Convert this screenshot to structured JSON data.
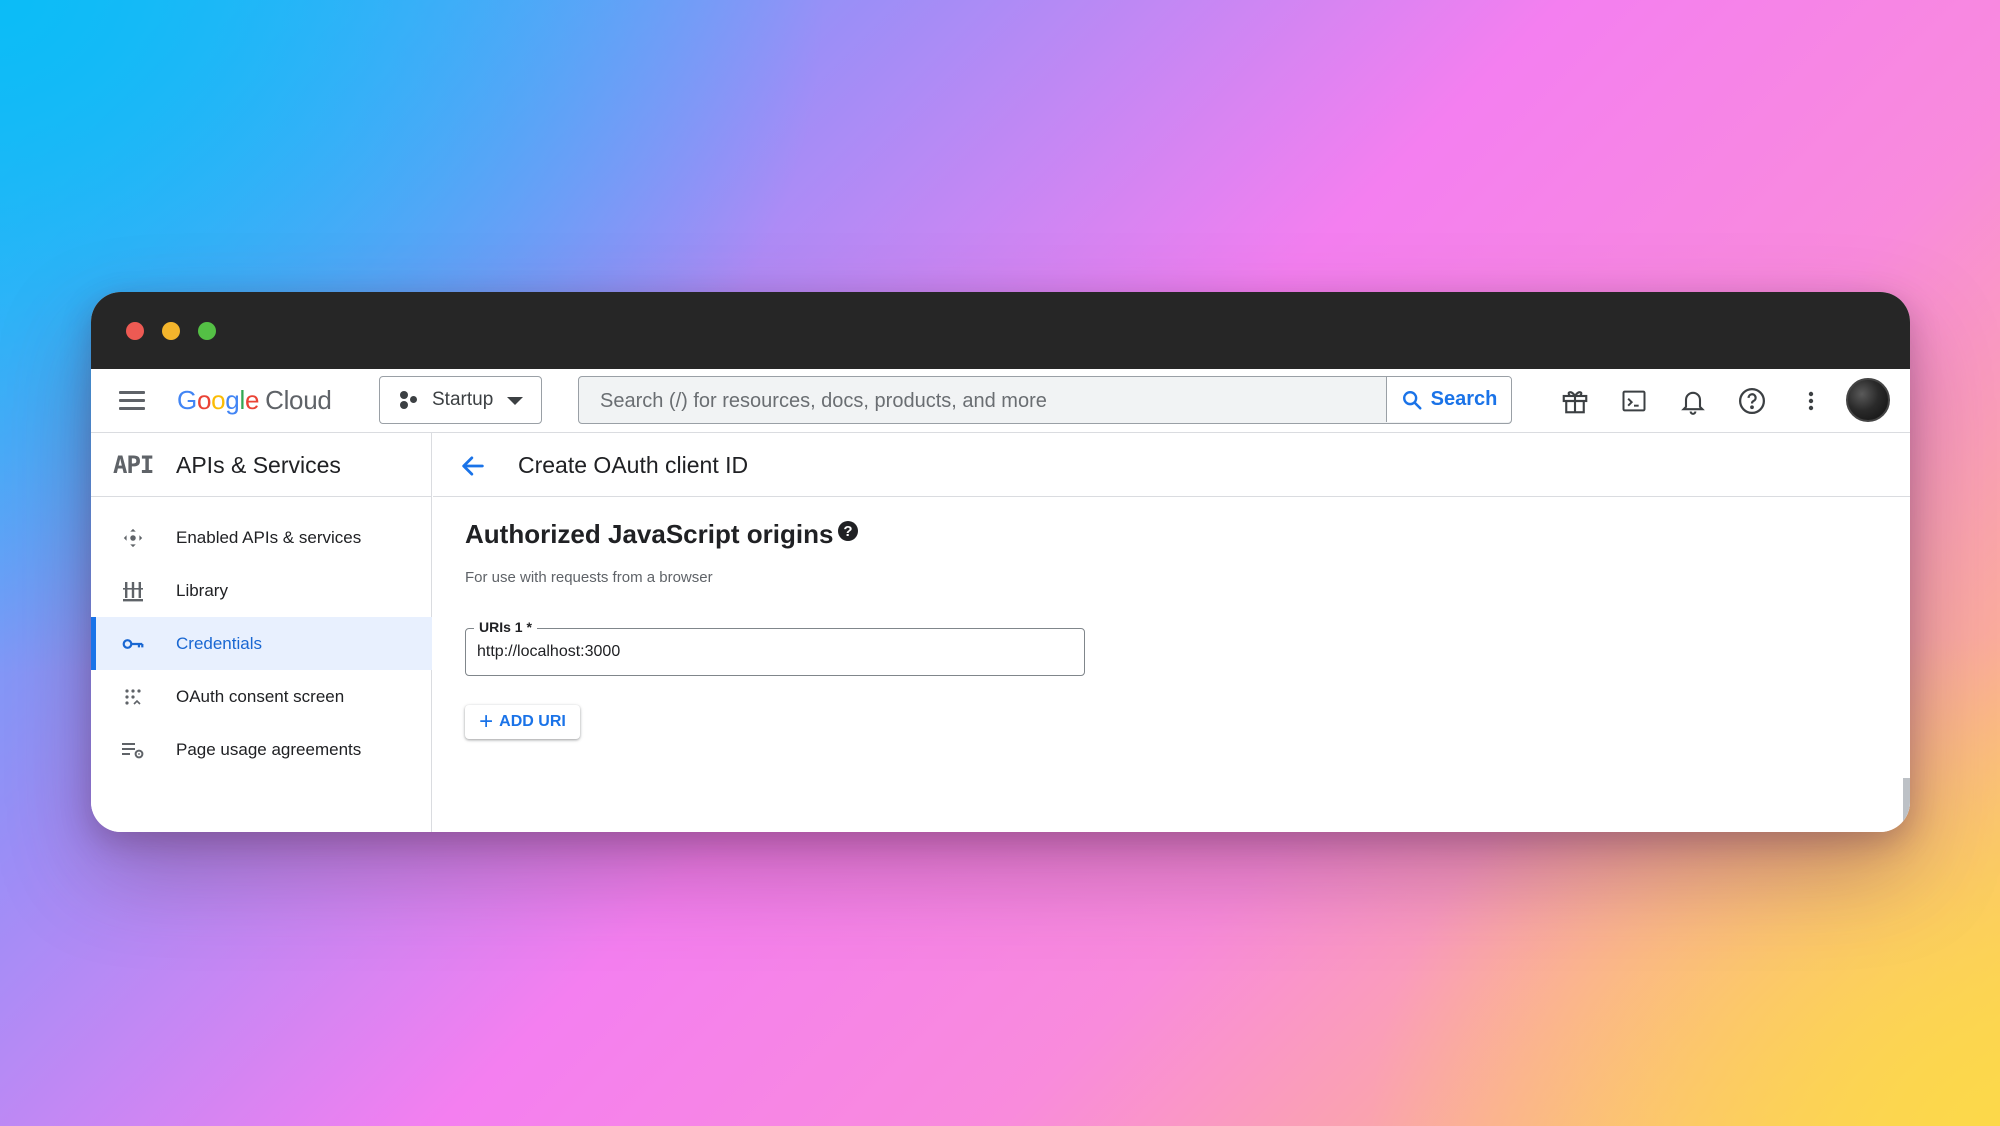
{
  "window": {
    "controls": [
      "close",
      "minimize",
      "maximize"
    ]
  },
  "topbar": {
    "menu_icon": "hamburger-menu-icon",
    "logo": {
      "letters": [
        "G",
        "o",
        "o",
        "g",
        "l",
        "e"
      ],
      "product": "Cloud"
    },
    "project_selector": {
      "label": "Startup"
    },
    "search": {
      "placeholder": "Search (/) for resources, docs, products, and more",
      "button_label": "Search"
    },
    "icons": [
      "gift-icon",
      "cloud-shell-icon",
      "notifications-icon",
      "help-icon",
      "more-vert-icon",
      "avatar"
    ]
  },
  "sidebar": {
    "badge": "API",
    "title": "APIs & Services",
    "items": [
      {
        "label": "Enabled APIs & services",
        "icon": "enabled-apis-icon",
        "active": false
      },
      {
        "label": "Library",
        "icon": "library-icon",
        "active": false
      },
      {
        "label": "Credentials",
        "icon": "key-icon",
        "active": true
      },
      {
        "label": "OAuth consent screen",
        "icon": "consent-icon",
        "active": false
      },
      {
        "label": "Page usage agreements",
        "icon": "settings-list-icon",
        "active": false
      }
    ]
  },
  "main": {
    "page_title": "Create OAuth client ID",
    "section_title": "Authorized JavaScript origins",
    "help_glyph": "?",
    "hint": "For use with requests from a browser",
    "uri_field": {
      "label": "URIs 1 *",
      "value": "http://localhost:3000"
    },
    "add_button": {
      "icon": "+",
      "label": "ADD URI"
    }
  },
  "colors": {
    "accent": "#1a73e8",
    "active_bg": "#e8f0fe",
    "titlebar": "#262626"
  }
}
